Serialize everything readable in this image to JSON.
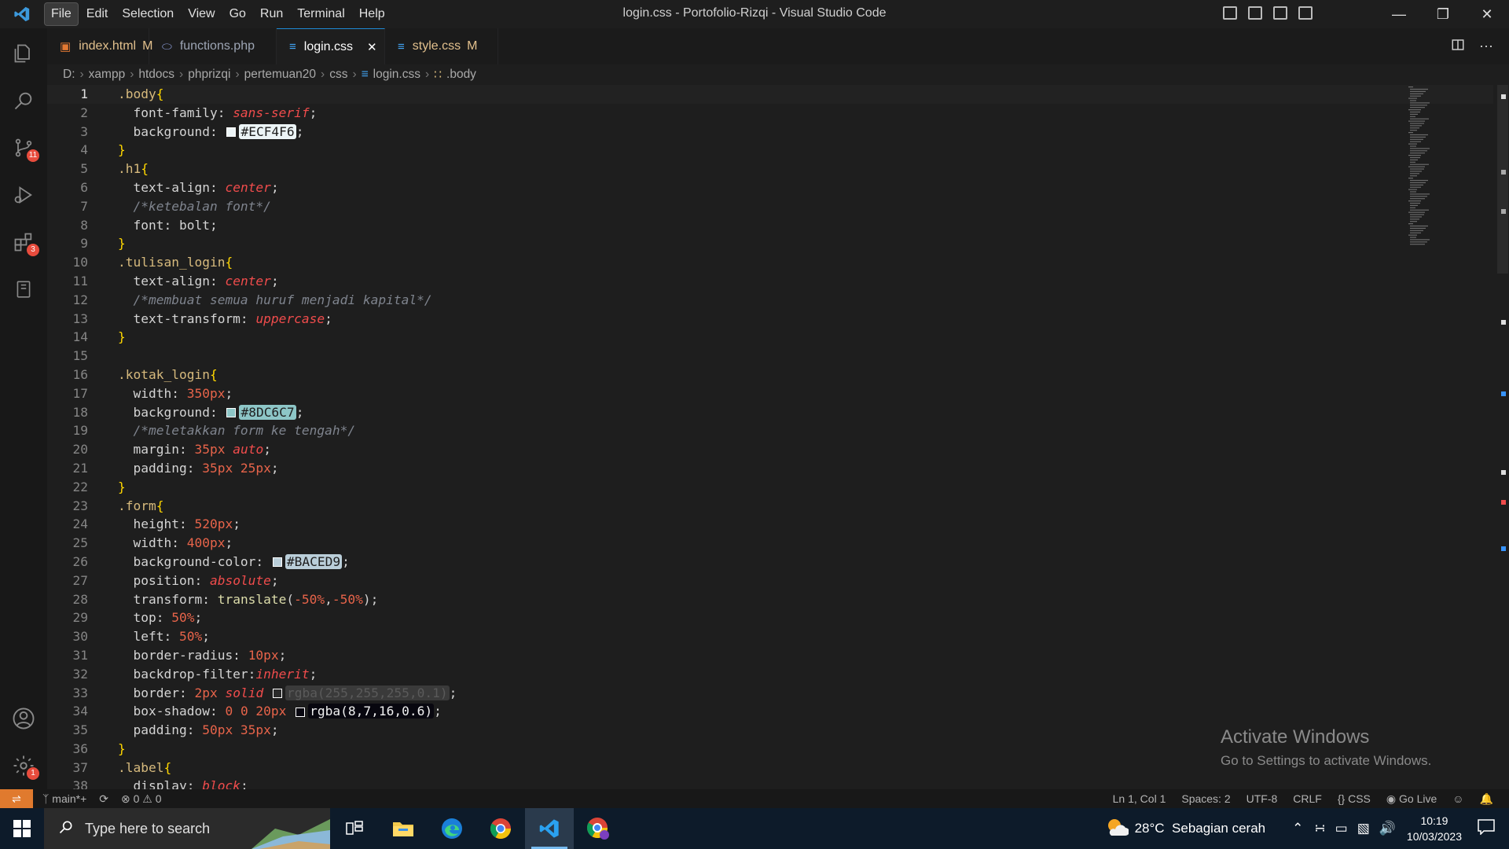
{
  "window": {
    "title": "login.css - Portofolio-Rizqi - Visual Studio Code",
    "menu": [
      "File",
      "Edit",
      "Selection",
      "View",
      "Go",
      "Run",
      "Terminal",
      "Help"
    ]
  },
  "activity_bar": {
    "badges": {
      "source_control": "11",
      "extensions": "3",
      "settings": "1"
    }
  },
  "tabs": [
    {
      "label": "index.html",
      "mod": "M",
      "icon": "html-icon",
      "color": "#e37933"
    },
    {
      "label": "functions.php",
      "mod": "",
      "icon": "php-icon",
      "color": "#8a9bd6"
    },
    {
      "label": "login.css",
      "mod": "",
      "icon": "css-icon",
      "color": "#42a5f5",
      "active": true
    },
    {
      "label": "style.css",
      "mod": "M",
      "icon": "css-icon",
      "color": "#42a5f5"
    }
  ],
  "breadcrumb": [
    "D:",
    "xampp",
    "htdocs",
    "phprizqi",
    "pertemuan20",
    "css",
    "login.css",
    ".body"
  ],
  "code_lines": [
    {
      "n": "1",
      "t": [
        [
          "sel",
          ".body"
        ],
        [
          "brace",
          "{"
        ]
      ]
    },
    {
      "n": "2",
      "t": [
        [
          "prop",
          "  font-family: "
        ],
        [
          "val",
          "sans-serif"
        ],
        [
          "prop",
          ";"
        ]
      ]
    },
    {
      "n": "3",
      "t": [
        [
          "prop",
          "  background: "
        ],
        [
          "swatch",
          "#ECF4F6"
        ],
        [
          "hex",
          "#ECF4F6"
        ],
        [
          "prop",
          ";"
        ]
      ]
    },
    {
      "n": "4",
      "t": [
        [
          "brace",
          "}"
        ]
      ]
    },
    {
      "n": "5",
      "t": [
        [
          "sel",
          ".h1"
        ],
        [
          "brace",
          "{"
        ]
      ]
    },
    {
      "n": "6",
      "t": [
        [
          "prop",
          "  text-align: "
        ],
        [
          "val",
          "center"
        ],
        [
          "prop",
          ";"
        ]
      ]
    },
    {
      "n": "7",
      "t": [
        [
          "cmt",
          "  /*ketebalan font*/"
        ]
      ]
    },
    {
      "n": "8",
      "t": [
        [
          "prop",
          "  font: bolt;"
        ]
      ]
    },
    {
      "n": "9",
      "t": [
        [
          "brace",
          "}"
        ]
      ]
    },
    {
      "n": "10",
      "t": [
        [
          "sel",
          ".tulisan_login"
        ],
        [
          "brace",
          "{"
        ]
      ]
    },
    {
      "n": "11",
      "t": [
        [
          "prop",
          "  text-align: "
        ],
        [
          "val",
          "center"
        ],
        [
          "prop",
          ";"
        ]
      ]
    },
    {
      "n": "12",
      "t": [
        [
          "cmt",
          "  /*membuat semua huruf menjadi kapital*/"
        ]
      ]
    },
    {
      "n": "13",
      "t": [
        [
          "prop",
          "  text-transform: "
        ],
        [
          "val",
          "uppercase"
        ],
        [
          "prop",
          ";"
        ]
      ]
    },
    {
      "n": "14",
      "t": [
        [
          "brace",
          "}"
        ]
      ]
    },
    {
      "n": "15",
      "t": []
    },
    {
      "n": "16",
      "t": [
        [
          "sel",
          ".kotak_login"
        ],
        [
          "brace",
          "{"
        ]
      ]
    },
    {
      "n": "17",
      "t": [
        [
          "prop",
          "  width: "
        ],
        [
          "num",
          "350px"
        ],
        [
          "prop",
          ";"
        ]
      ]
    },
    {
      "n": "18",
      "t": [
        [
          "prop",
          "  background: "
        ],
        [
          "swatch",
          "#8DC6C7"
        ],
        [
          "hex",
          "#8DC6C7"
        ],
        [
          "prop",
          ";"
        ]
      ]
    },
    {
      "n": "19",
      "t": [
        [
          "cmt",
          "  /*meletakkan form ke tengah*/"
        ]
      ]
    },
    {
      "n": "20",
      "t": [
        [
          "prop",
          "  margin: "
        ],
        [
          "num",
          "35px"
        ],
        [
          "prop",
          " "
        ],
        [
          "val",
          "auto"
        ],
        [
          "prop",
          ";"
        ]
      ]
    },
    {
      "n": "21",
      "t": [
        [
          "prop",
          "  padding: "
        ],
        [
          "num",
          "35px 25px"
        ],
        [
          "prop",
          ";"
        ]
      ]
    },
    {
      "n": "22",
      "t": [
        [
          "brace",
          "}"
        ]
      ]
    },
    {
      "n": "23",
      "t": [
        [
          "sel",
          ".form"
        ],
        [
          "brace",
          "{"
        ]
      ]
    },
    {
      "n": "24",
      "t": [
        [
          "prop",
          "  height: "
        ],
        [
          "num",
          "520px"
        ],
        [
          "prop",
          ";"
        ]
      ]
    },
    {
      "n": "25",
      "t": [
        [
          "prop",
          "  width: "
        ],
        [
          "num",
          "400px"
        ],
        [
          "prop",
          ";"
        ]
      ]
    },
    {
      "n": "26",
      "t": [
        [
          "prop",
          "  background-color: "
        ],
        [
          "swatch",
          "#BACED9"
        ],
        [
          "hex",
          "#BACED9"
        ],
        [
          "prop",
          ";"
        ]
      ]
    },
    {
      "n": "27",
      "t": [
        [
          "prop",
          "  position: "
        ],
        [
          "val",
          "absolute"
        ],
        [
          "prop",
          ";"
        ]
      ]
    },
    {
      "n": "28",
      "t": [
        [
          "prop",
          "  transform: "
        ],
        [
          "fn",
          "translate"
        ],
        [
          "prop",
          "("
        ],
        [
          "num",
          "-50%"
        ],
        [
          "prop",
          ","
        ],
        [
          "num",
          "-50%"
        ],
        [
          "prop",
          ");"
        ]
      ]
    },
    {
      "n": "29",
      "t": [
        [
          "prop",
          "  top: "
        ],
        [
          "num",
          "50%"
        ],
        [
          "prop",
          ";"
        ]
      ]
    },
    {
      "n": "30",
      "t": [
        [
          "prop",
          "  left: "
        ],
        [
          "num",
          "50%"
        ],
        [
          "prop",
          ";"
        ]
      ]
    },
    {
      "n": "31",
      "t": [
        [
          "prop",
          "  border-radius: "
        ],
        [
          "num",
          "10px"
        ],
        [
          "prop",
          ";"
        ]
      ]
    },
    {
      "n": "32",
      "t": [
        [
          "prop",
          "  backdrop-filter:"
        ],
        [
          "val",
          "inherit"
        ],
        [
          "prop",
          ";"
        ]
      ]
    },
    {
      "n": "33",
      "t": [
        [
          "prop",
          "  border: "
        ],
        [
          "num",
          "2px"
        ],
        [
          "prop",
          " "
        ],
        [
          "val",
          "solid"
        ],
        [
          "prop",
          " "
        ],
        [
          "swatch",
          "#2a2a2a"
        ],
        [
          "hexdim",
          "rgba(255,255,255,0.1)"
        ],
        [
          "prop",
          ";"
        ]
      ]
    },
    {
      "n": "34",
      "t": [
        [
          "prop",
          "  box-shadow: "
        ],
        [
          "num",
          "0 0 20px"
        ],
        [
          "prop",
          " "
        ],
        [
          "swatch",
          "#080710"
        ],
        [
          "hexdark",
          "rgba(8,7,16,0.6)"
        ],
        [
          "prop",
          ";"
        ]
      ]
    },
    {
      "n": "35",
      "t": [
        [
          "prop",
          "  padding: "
        ],
        [
          "num",
          "50px 35px"
        ],
        [
          "prop",
          ";"
        ]
      ]
    },
    {
      "n": "36",
      "t": [
        [
          "brace",
          "}"
        ]
      ]
    },
    {
      "n": "37",
      "t": [
        [
          "sel",
          ".label"
        ],
        [
          "brace",
          "{"
        ]
      ]
    },
    {
      "n": "38",
      "t": [
        [
          "prop",
          "  display: "
        ],
        [
          "val",
          "block"
        ],
        [
          "prop",
          ";"
        ]
      ]
    }
  ],
  "watermark": {
    "line1": "Activate Windows",
    "line2": "Go to Settings to activate Windows."
  },
  "statusbar": {
    "branch": "main*+",
    "errors": "0",
    "warnings": "0",
    "position": "Ln 1, Col 1",
    "spaces": "Spaces: 2",
    "encoding": "UTF-8",
    "eol": "CRLF",
    "language": "CSS",
    "golive": "Go Live"
  },
  "taskbar": {
    "search_placeholder": "Type here to search",
    "weather": "28°C  Sebagian cerah",
    "time": "10:19",
    "date": "10/03/2023"
  }
}
